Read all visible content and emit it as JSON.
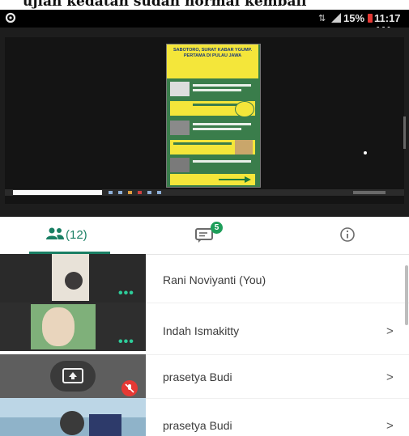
{
  "caption": {
    "text": "ujian kedatan sudah normal kembali"
  },
  "status_bar": {
    "wifi_label": "⇅",
    "battery": "15%",
    "time": "11:17 AM"
  },
  "shared_slide": {
    "title": "SABOTORO, SURAT KABAR YGUMP. PERTAMA DI PULAU JAWA"
  },
  "tabs": {
    "people_count": "(12)",
    "chat_badge": "5",
    "icons": {
      "people": "people-icon",
      "chat": "chat-icon",
      "info": "info-icon"
    }
  },
  "participants": [
    {
      "name": "Rani Noviyanti (You)",
      "chevron": ""
    },
    {
      "name": "Indah Ismakitty",
      "chevron": ">"
    },
    {
      "name": "prasetya Budi",
      "chevron": ">"
    },
    {
      "name": "prasetya Budi",
      "chevron": ">"
    }
  ],
  "colors": {
    "accent": "#1a7f64",
    "badge": "#1e9e5a",
    "muted_red": "#e53935"
  }
}
